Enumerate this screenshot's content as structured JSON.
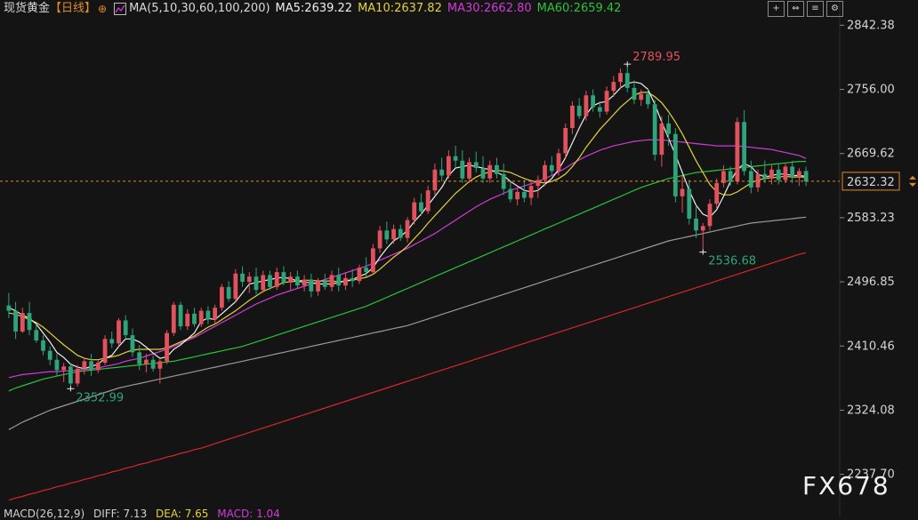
{
  "header": {
    "symbol": "现货黄金",
    "period": "【日线】",
    "add_icon": "add-circle-icon",
    "ma_icon": "chart-icon",
    "ma_params": "MA(5,10,30,60,100,200)",
    "ma5": "MA5:2639.22",
    "ma10": "MA10:2637.82",
    "ma30": "MA30:2662.80",
    "ma60": "MA60:2659.42"
  },
  "tools": [
    "add-icon",
    "resize-icon",
    "list-icon",
    "settings-icon"
  ],
  "macd_header": {
    "label": "MACD(26,12,9)",
    "diff": "DIFF: 7.13",
    "dea": "DEA: 7.65",
    "macd": "MACD: 1.04"
  },
  "watermark": "FX678",
  "colors": {
    "background": "#141414",
    "up": "#e0525c",
    "down": "#2fa37a",
    "ma5": "#eeeeee",
    "ma10": "#e3d23a",
    "ma30": "#d23ad8",
    "ma60": "#28c43a",
    "ma100": "#9a9a9a",
    "ma200": "#d8262a",
    "last_price_line": "#e08a2b"
  },
  "chart_data": {
    "type": "candlestick",
    "title": "现货黄金【日线】",
    "y_ticks": [
      2842.38,
      2756.0,
      2669.62,
      2583.23,
      2496.85,
      2410.46,
      2324.08,
      2237.7
    ],
    "ylim": [
      2199,
      2850
    ],
    "last_price": "2632.32",
    "annotations": {
      "high": "2789.95",
      "low_left": "2352.99",
      "low_right": "2536.68"
    },
    "bars": [
      [
        2465,
        2482,
        2448,
        2458
      ],
      [
        2458,
        2470,
        2420,
        2430
      ],
      [
        2430,
        2462,
        2428,
        2455
      ],
      [
        2455,
        2470,
        2425,
        2432
      ],
      [
        2432,
        2440,
        2415,
        2418
      ],
      [
        2418,
        2425,
        2398,
        2404
      ],
      [
        2404,
        2410,
        2385,
        2392
      ],
      [
        2392,
        2400,
        2370,
        2378
      ],
      [
        2378,
        2388,
        2362,
        2383
      ],
      [
        2383,
        2387,
        2353,
        2360
      ],
      [
        2360,
        2385,
        2356,
        2380
      ],
      [
        2380,
        2395,
        2372,
        2390
      ],
      [
        2390,
        2400,
        2370,
        2378
      ],
      [
        2378,
        2392,
        2374,
        2388
      ],
      [
        2388,
        2425,
        2385,
        2420
      ],
      [
        2420,
        2430,
        2408,
        2414
      ],
      [
        2414,
        2448,
        2410,
        2445
      ],
      [
        2445,
        2452,
        2420,
        2425
      ],
      [
        2425,
        2434,
        2396,
        2402
      ],
      [
        2402,
        2412,
        2378,
        2386
      ],
      [
        2386,
        2400,
        2375,
        2392
      ],
      [
        2392,
        2398,
        2376,
        2380
      ],
      [
        2380,
        2394,
        2360,
        2390
      ],
      [
        2390,
        2432,
        2386,
        2428
      ],
      [
        2428,
        2470,
        2424,
        2466
      ],
      [
        2466,
        2470,
        2432,
        2437
      ],
      [
        2437,
        2460,
        2432,
        2454
      ],
      [
        2454,
        2462,
        2436,
        2440
      ],
      [
        2440,
        2462,
        2436,
        2458
      ],
      [
        2458,
        2464,
        2440,
        2446
      ],
      [
        2446,
        2466,
        2440,
        2462
      ],
      [
        2462,
        2494,
        2458,
        2490
      ],
      [
        2490,
        2498,
        2470,
        2474
      ],
      [
        2474,
        2514,
        2470,
        2508
      ],
      [
        2508,
        2518,
        2490,
        2497
      ],
      [
        2497,
        2510,
        2482,
        2504
      ],
      [
        2504,
        2516,
        2480,
        2486
      ],
      [
        2486,
        2512,
        2482,
        2506
      ],
      [
        2506,
        2512,
        2486,
        2490
      ],
      [
        2490,
        2516,
        2486,
        2510
      ],
      [
        2510,
        2518,
        2492,
        2496
      ],
      [
        2496,
        2510,
        2486,
        2504
      ],
      [
        2504,
        2512,
        2488,
        2492
      ],
      [
        2492,
        2506,
        2484,
        2500
      ],
      [
        2500,
        2508,
        2476,
        2484
      ],
      [
        2484,
        2502,
        2478,
        2498
      ],
      [
        2498,
        2508,
        2486,
        2490
      ],
      [
        2490,
        2512,
        2484,
        2506
      ],
      [
        2506,
        2516,
        2484,
        2492
      ],
      [
        2492,
        2510,
        2486,
        2502
      ],
      [
        2502,
        2514,
        2490,
        2498
      ],
      [
        2498,
        2520,
        2494,
        2516
      ],
      [
        2516,
        2530,
        2504,
        2510
      ],
      [
        2510,
        2548,
        2506,
        2542
      ],
      [
        2542,
        2572,
        2536,
        2566
      ],
      [
        2566,
        2578,
        2548,
        2554
      ],
      [
        2554,
        2574,
        2548,
        2568
      ],
      [
        2568,
        2574,
        2552,
        2556
      ],
      [
        2556,
        2584,
        2550,
        2580
      ],
      [
        2580,
        2610,
        2574,
        2604
      ],
      [
        2604,
        2616,
        2586,
        2592
      ],
      [
        2592,
        2626,
        2588,
        2620
      ],
      [
        2620,
        2656,
        2614,
        2648
      ],
      [
        2648,
        2664,
        2632,
        2640
      ],
      [
        2640,
        2674,
        2636,
        2666
      ],
      [
        2666,
        2680,
        2650,
        2660
      ],
      [
        2660,
        2674,
        2630,
        2636
      ],
      [
        2636,
        2664,
        2630,
        2658
      ],
      [
        2658,
        2672,
        2644,
        2650
      ],
      [
        2650,
        2666,
        2630,
        2636
      ],
      [
        2636,
        2660,
        2630,
        2654
      ],
      [
        2654,
        2664,
        2636,
        2642
      ],
      [
        2642,
        2656,
        2614,
        2622
      ],
      [
        2622,
        2632,
        2604,
        2608
      ],
      [
        2608,
        2622,
        2600,
        2618
      ],
      [
        2618,
        2634,
        2604,
        2610
      ],
      [
        2610,
        2632,
        2600,
        2626
      ],
      [
        2626,
        2640,
        2610,
        2634
      ],
      [
        2634,
        2660,
        2626,
        2654
      ],
      [
        2654,
        2666,
        2640,
        2646
      ],
      [
        2646,
        2676,
        2640,
        2670
      ],
      [
        2670,
        2710,
        2664,
        2704
      ],
      [
        2704,
        2740,
        2696,
        2734
      ],
      [
        2734,
        2744,
        2716,
        2720
      ],
      [
        2720,
        2754,
        2714,
        2748
      ],
      [
        2748,
        2756,
        2726,
        2732
      ],
      [
        2732,
        2740,
        2718,
        2726
      ],
      [
        2726,
        2760,
        2722,
        2754
      ],
      [
        2754,
        2774,
        2746,
        2766
      ],
      [
        2766,
        2784,
        2756,
        2778
      ],
      [
        2778,
        2790,
        2752,
        2758
      ],
      [
        2758,
        2768,
        2736,
        2742
      ],
      [
        2742,
        2756,
        2734,
        2750
      ],
      [
        2750,
        2758,
        2730,
        2736
      ],
      [
        2736,
        2742,
        2660,
        2668
      ],
      [
        2668,
        2720,
        2652,
        2710
      ],
      [
        2710,
        2722,
        2680,
        2696
      ],
      [
        2696,
        2704,
        2604,
        2612
      ],
      [
        2612,
        2640,
        2590,
        2622
      ],
      [
        2622,
        2634,
        2574,
        2582
      ],
      [
        2582,
        2600,
        2556,
        2566
      ],
      [
        2566,
        2576,
        2537,
        2572
      ],
      [
        2572,
        2608,
        2566,
        2602
      ],
      [
        2602,
        2636,
        2596,
        2630
      ],
      [
        2630,
        2654,
        2624,
        2646
      ],
      [
        2646,
        2652,
        2626,
        2632
      ],
      [
        2632,
        2718,
        2628,
        2712
      ],
      [
        2712,
        2728,
        2640,
        2646
      ],
      [
        2646,
        2660,
        2616,
        2624
      ],
      [
        2624,
        2648,
        2618,
        2642
      ],
      [
        2642,
        2660,
        2630,
        2636
      ],
      [
        2636,
        2654,
        2628,
        2648
      ],
      [
        2648,
        2656,
        2628,
        2634
      ],
      [
        2634,
        2656,
        2630,
        2652
      ],
      [
        2652,
        2660,
        2630,
        2638
      ],
      [
        2638,
        2650,
        2626,
        2646
      ],
      [
        2646,
        2652,
        2626,
        2632
      ]
    ],
    "ma5": [
      2462,
      2458,
      2452,
      2448,
      2440,
      2428,
      2416,
      2402,
      2395,
      2386,
      2382,
      2380,
      2383,
      2386,
      2394,
      2398,
      2410,
      2420,
      2420,
      2416,
      2409,
      2401,
      2394,
      2396,
      2406,
      2412,
      2420,
      2428,
      2444,
      2448,
      2446,
      2454,
      2462,
      2470,
      2482,
      2494,
      2496,
      2498,
      2500,
      2502,
      2503,
      2501,
      2498,
      2496,
      2496,
      2494,
      2494,
      2494,
      2496,
      2498,
      2500,
      2504,
      2508,
      2516,
      2530,
      2542,
      2552,
      2558,
      2566,
      2578,
      2588,
      2600,
      2612,
      2624,
      2640,
      2650,
      2652,
      2654,
      2652,
      2650,
      2648,
      2644,
      2640,
      2632,
      2626,
      2620,
      2618,
      2620,
      2628,
      2636,
      2648,
      2664,
      2684,
      2704,
      2722,
      2734,
      2738,
      2740,
      2748,
      2758,
      2764,
      2766,
      2764,
      2756,
      2736,
      2712,
      2690,
      2668,
      2644,
      2620,
      2600,
      2588,
      2584,
      2594,
      2612,
      2632,
      2648,
      2656,
      2652,
      2642,
      2638,
      2640,
      2642,
      2642,
      2640,
      2640,
      2639
    ],
    "ma10": [
      2455,
      2453,
      2450,
      2446,
      2442,
      2436,
      2428,
      2420,
      2412,
      2405,
      2398,
      2394,
      2392,
      2392,
      2394,
      2396,
      2398,
      2402,
      2405,
      2406,
      2406,
      2406,
      2406,
      2408,
      2412,
      2416,
      2420,
      2424,
      2430,
      2436,
      2440,
      2446,
      2452,
      2458,
      2465,
      2472,
      2478,
      2484,
      2488,
      2492,
      2496,
      2497,
      2498,
      2499,
      2499,
      2498,
      2498,
      2498,
      2497,
      2498,
      2499,
      2501,
      2503,
      2507,
      2514,
      2522,
      2530,
      2537,
      2545,
      2555,
      2565,
      2576,
      2586,
      2596,
      2606,
      2616,
      2624,
      2632,
      2638,
      2642,
      2645,
      2647,
      2646,
      2644,
      2640,
      2636,
      2633,
      2631,
      2630,
      2632,
      2636,
      2642,
      2652,
      2664,
      2678,
      2690,
      2702,
      2712,
      2722,
      2732,
      2740,
      2748,
      2752,
      2752,
      2746,
      2738,
      2726,
      2712,
      2696,
      2678,
      2660,
      2644,
      2628,
      2618,
      2614,
      2614,
      2618,
      2624,
      2630,
      2634,
      2636,
      2637,
      2638,
      2639,
      2638,
      2638,
      2638
    ],
    "ma30": [
      2368,
      2370,
      2372,
      2373,
      2374,
      2375,
      2376,
      2376,
      2377,
      2377,
      2378,
      2379,
      2380,
      2381,
      2383,
      2385,
      2387,
      2390,
      2392,
      2394,
      2397,
      2400,
      2403,
      2406,
      2410,
      2414,
      2418,
      2422,
      2427,
      2432,
      2437,
      2442,
      2447,
      2452,
      2457,
      2462,
      2467,
      2471,
      2475,
      2479,
      2482,
      2485,
      2488,
      2491,
      2494,
      2497,
      2500,
      2503,
      2506,
      2509,
      2512,
      2515,
      2518,
      2522,
      2526,
      2530,
      2534,
      2538,
      2542,
      2547,
      2552,
      2557,
      2562,
      2568,
      2574,
      2580,
      2586,
      2592,
      2598,
      2603,
      2608,
      2612,
      2616,
      2620,
      2623,
      2626,
      2629,
      2632,
      2636,
      2640,
      2645,
      2650,
      2656,
      2661,
      2666,
      2670,
      2674,
      2677,
      2680,
      2682,
      2684,
      2686,
      2687,
      2688,
      2688,
      2688,
      2687,
      2686,
      2685,
      2684,
      2683,
      2682,
      2681,
      2680,
      2680,
      2680,
      2680,
      2679,
      2678,
      2677,
      2676,
      2675,
      2673,
      2671,
      2669,
      2667,
      2663
    ],
    "ma60": [
      2350,
      2354,
      2357,
      2360,
      2363,
      2366,
      2368,
      2370,
      2372,
      2374,
      2376,
      2377,
      2378,
      2379,
      2380,
      2381,
      2382,
      2383,
      2384,
      2385,
      2386,
      2387,
      2388,
      2389,
      2390,
      2392,
      2394,
      2396,
      2398,
      2400,
      2402,
      2404,
      2406,
      2408,
      2410,
      2413,
      2416,
      2419,
      2422,
      2425,
      2428,
      2431,
      2434,
      2437,
      2440,
      2443,
      2446,
      2449,
      2452,
      2455,
      2458,
      2461,
      2464,
      2468,
      2472,
      2476,
      2480,
      2484,
      2488,
      2492,
      2496,
      2500,
      2504,
      2508,
      2512,
      2516,
      2520,
      2524,
      2528,
      2532,
      2536,
      2540,
      2544,
      2548,
      2552,
      2556,
      2560,
      2564,
      2568,
      2572,
      2576,
      2580,
      2584,
      2588,
      2592,
      2596,
      2600,
      2604,
      2608,
      2612,
      2616,
      2620,
      2624,
      2627,
      2630,
      2633,
      2636,
      2638,
      2640,
      2642,
      2644,
      2645,
      2646,
      2647,
      2648,
      2649,
      2650,
      2651,
      2652,
      2653,
      2654,
      2655,
      2656,
      2657,
      2658,
      2659,
      2659
    ],
    "ma100": [
      2298,
      2303,
      2308,
      2312,
      2316,
      2320,
      2324,
      2327,
      2330,
      2333,
      2336,
      2339,
      2342,
      2345,
      2348,
      2351,
      2354,
      2356,
      2358,
      2360,
      2362,
      2364,
      2366,
      2368,
      2370,
      2372,
      2374,
      2376,
      2378,
      2380,
      2382,
      2384,
      2386,
      2388,
      2390,
      2392,
      2394,
      2396,
      2398,
      2400,
      2402,
      2404,
      2406,
      2408,
      2410,
      2412,
      2414,
      2416,
      2418,
      2420,
      2422,
      2424,
      2426,
      2428,
      2430,
      2432,
      2434,
      2436,
      2438,
      2441,
      2444,
      2447,
      2450,
      2453,
      2456,
      2459,
      2462,
      2465,
      2468,
      2471,
      2474,
      2477,
      2480,
      2483,
      2486,
      2489,
      2492,
      2495,
      2498,
      2501,
      2504,
      2507,
      2510,
      2513,
      2516,
      2519,
      2522,
      2525,
      2528,
      2531,
      2534,
      2537,
      2540,
      2543,
      2546,
      2549,
      2552,
      2554,
      2556,
      2558,
      2560,
      2562,
      2564,
      2566,
      2568,
      2570,
      2572,
      2574,
      2576,
      2577,
      2578,
      2579,
      2580,
      2581,
      2582,
      2583,
      2584
    ],
    "ma200": [
      2203,
      2206,
      2208,
      2211,
      2213,
      2216,
      2218,
      2221,
      2223,
      2226,
      2228,
      2231,
      2233,
      2236,
      2238,
      2241,
      2243,
      2246,
      2248,
      2251,
      2253,
      2256,
      2258,
      2261,
      2263,
      2266,
      2268,
      2271,
      2273,
      2276,
      2279,
      2282,
      2285,
      2288,
      2291,
      2294,
      2297,
      2300,
      2303,
      2306,
      2309,
      2312,
      2315,
      2318,
      2321,
      2324,
      2327,
      2330,
      2333,
      2336,
      2339,
      2342,
      2345,
      2348,
      2351,
      2354,
      2357,
      2360,
      2363,
      2366,
      2369,
      2372,
      2375,
      2378,
      2381,
      2384,
      2387,
      2390,
      2393,
      2396,
      2399,
      2402,
      2405,
      2408,
      2411,
      2414,
      2417,
      2420,
      2423,
      2426,
      2429,
      2432,
      2435,
      2438,
      2441,
      2444,
      2447,
      2450,
      2453,
      2456,
      2459,
      2462,
      2465,
      2468,
      2471,
      2474,
      2477,
      2480,
      2483,
      2486,
      2489,
      2492,
      2495,
      2498,
      2501,
      2504,
      2507,
      2510,
      2513,
      2516,
      2519,
      2522,
      2525,
      2528,
      2531,
      2534,
      2536
    ]
  }
}
